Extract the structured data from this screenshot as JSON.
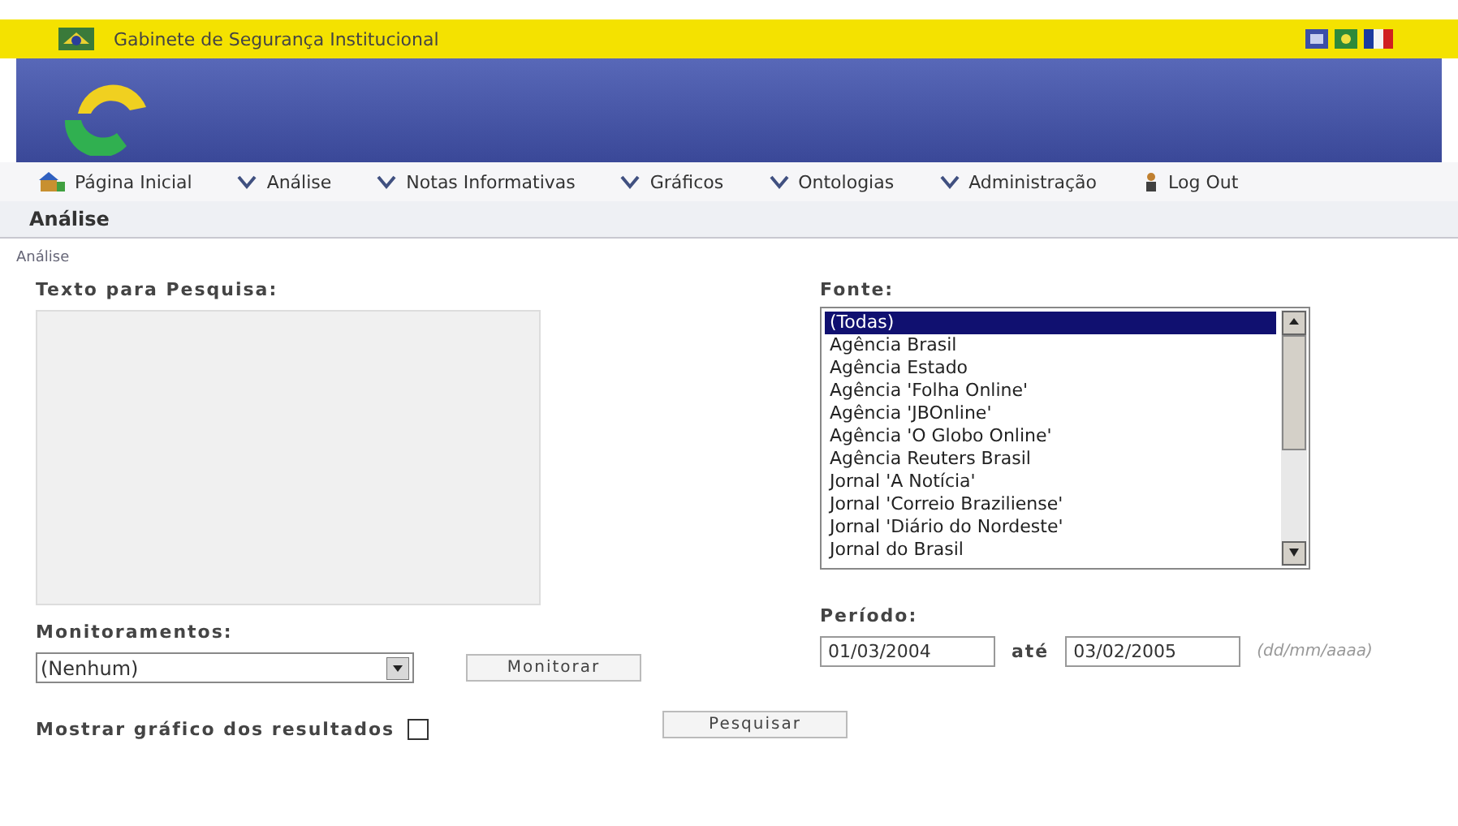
{
  "header": {
    "title": "Gabinete de Segurança Institucional"
  },
  "nav": [
    {
      "label": "Página Inicial",
      "kind": "home"
    },
    {
      "label": "Análise",
      "kind": "section"
    },
    {
      "label": "Notas Informativas",
      "kind": "section"
    },
    {
      "label": "Gráficos",
      "kind": "section"
    },
    {
      "label": "Ontologias",
      "kind": "section"
    },
    {
      "label": "Administração",
      "kind": "section"
    },
    {
      "label": "Log Out",
      "kind": "logout"
    }
  ],
  "page_title": "Análise",
  "breadcrumb": "Análise",
  "search": {
    "label": "Texto para Pesquisa:"
  },
  "monitoring": {
    "label": "Monitoramentos:",
    "value": "(Nenhum)",
    "button": "Monitorar"
  },
  "show_chart": {
    "label": "Mostrar gráfico dos resultados",
    "checked": false
  },
  "submit": "Pesquisar",
  "source": {
    "label": "Fonte:",
    "items": [
      {
        "label": "(Todas)",
        "selected": true
      },
      {
        "label": "Agência Brasil",
        "selected": false
      },
      {
        "label": "Agência Estado",
        "selected": false
      },
      {
        "label": "Agência 'Folha Online'",
        "selected": false
      },
      {
        "label": "Agência 'JBOnline'",
        "selected": false
      },
      {
        "label": "Agência 'O Globo Online'",
        "selected": false
      },
      {
        "label": "Agência Reuters Brasil",
        "selected": false
      },
      {
        "label": "Jornal 'A Notícia'",
        "selected": false
      },
      {
        "label": "Jornal 'Correio Braziliense'",
        "selected": false
      },
      {
        "label": "Jornal 'Diário do Nordeste'",
        "selected": false
      },
      {
        "label": "Jornal do Brasil",
        "selected": false
      }
    ]
  },
  "period": {
    "label": "Período:",
    "from": "01/03/2004",
    "separator": "até",
    "to": "03/02/2005",
    "hint": "(dd/mm/aaaa)"
  }
}
